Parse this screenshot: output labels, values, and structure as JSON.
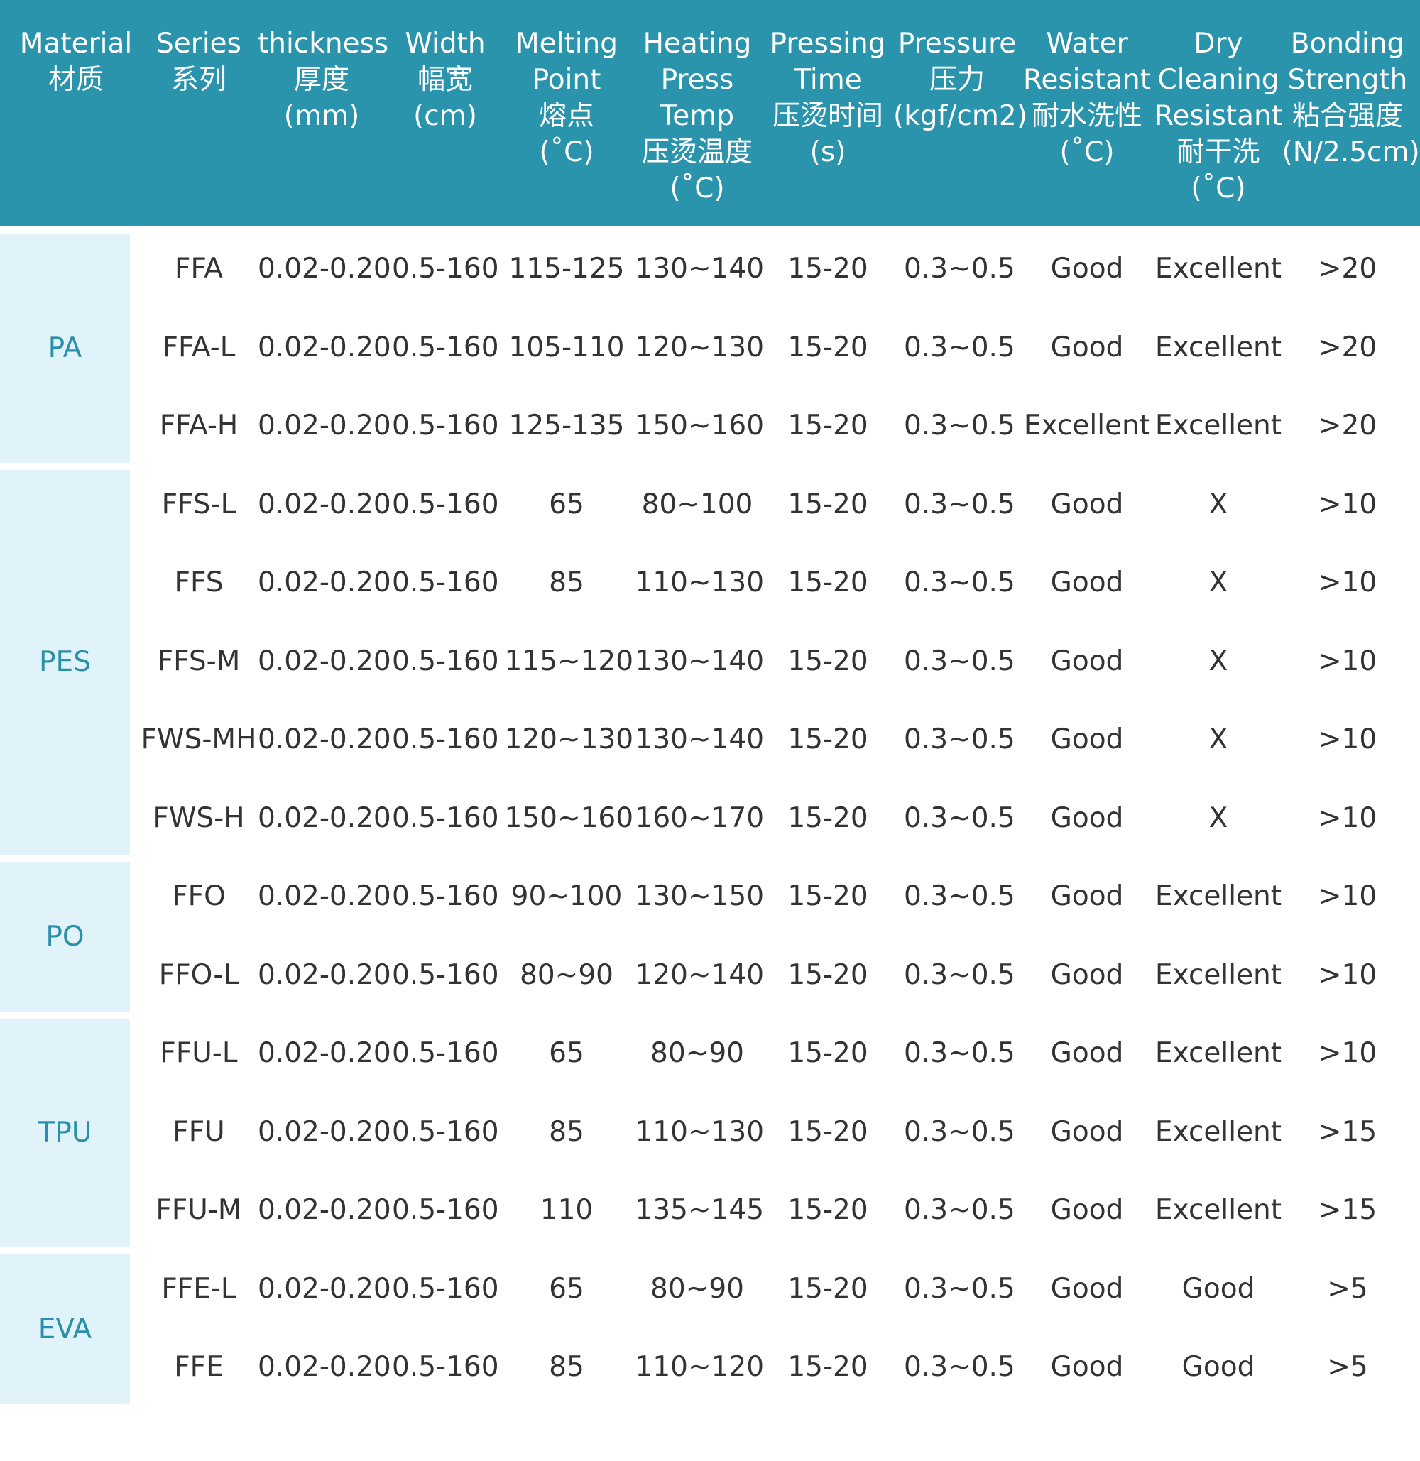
{
  "colors": {
    "header_bg": "#2a94ad",
    "header_text": "#ffffff",
    "group_bg": "#e1f3fa",
    "group_text": "#2a8fa8",
    "cell_text": "#333333"
  },
  "headers": [
    "Material\n材质",
    "Series\n系列",
    "thickness\n厚度\n(mm)",
    "Width\n幅宽\n(cm)",
    "Melting\nPoint\n熔点\n(˚C)",
    "Heating\nPress\nTemp\n压烫温度\n(˚C)",
    "Pressing\nTime\n压烫时间\n(s)",
    "Pressure\n压力\n(kgf/cm2)",
    "Water\nResistant\n耐水洗性\n(˚C)",
    "Dry\nCleaning\nResistant\n耐干洗\n(˚C)",
    "Bonding\nStrength\n粘合强度\n(N/2.5cm)"
  ],
  "groups": [
    {
      "material": "PA",
      "rows": [
        [
          "FFA",
          "0.02-0.20",
          "0.5-160",
          "115-125",
          "130~140",
          "15-20",
          "0.3~0.5",
          "Good",
          "Excellent",
          ">20"
        ],
        [
          "FFA-L",
          "0.02-0.20",
          "0.5-160",
          "105-110",
          "120~130",
          "15-20",
          "0.3~0.5",
          "Good",
          "Excellent",
          ">20"
        ],
        [
          "FFA-H",
          "0.02-0.20",
          "0.5-160",
          "125-135",
          "150~160",
          "15-20",
          "0.3~0.5",
          "Excellent",
          "Excellent",
          ">20"
        ]
      ]
    },
    {
      "material": "PES",
      "rows": [
        [
          "FFS-L",
          "0.02-0.20",
          "0.5-160",
          "65",
          "80~100",
          "15-20",
          "0.3~0.5",
          "Good",
          "X",
          ">10"
        ],
        [
          "FFS",
          "0.02-0.20",
          "0.5-160",
          "85",
          "110~130",
          "15-20",
          "0.3~0.5",
          "Good",
          "X",
          ">10"
        ],
        [
          "FFS-M",
          "0.02-0.20",
          "0.5-160",
          "115~120",
          "130~140",
          "15-20",
          "0.3~0.5",
          "Good",
          "X",
          ">10"
        ],
        [
          "FWS-MH",
          "0.02-0.20",
          "0.5-160",
          "120~130",
          "130~140",
          "15-20",
          "0.3~0.5",
          "Good",
          "X",
          ">10"
        ],
        [
          "FWS-H",
          "0.02-0.20",
          "0.5-160",
          "150~160",
          "160~170",
          "15-20",
          "0.3~0.5",
          "Good",
          "X",
          ">10"
        ]
      ]
    },
    {
      "material": "PO",
      "rows": [
        [
          "FFO",
          "0.02-0.20",
          "0.5-160",
          "90~100",
          "130~150",
          "15-20",
          "0.3~0.5",
          "Good",
          "Excellent",
          ">10"
        ],
        [
          "FFO-L",
          "0.02-0.20",
          "0.5-160",
          "80~90",
          "120~140",
          "15-20",
          "0.3~0.5",
          "Good",
          "Excellent",
          ">10"
        ]
      ]
    },
    {
      "material": "TPU",
      "rows": [
        [
          "FFU-L",
          "0.02-0.20",
          "0.5-160",
          "65",
          "80~90",
          "15-20",
          "0.3~0.5",
          "Good",
          "Excellent",
          ">10"
        ],
        [
          "FFU",
          "0.02-0.20",
          "0.5-160",
          "85",
          "110~130",
          "15-20",
          "0.3~0.5",
          "Good",
          "Excellent",
          ">15"
        ],
        [
          "FFU-M",
          "0.02-0.20",
          "0.5-160",
          "110",
          "135~145",
          "15-20",
          "0.3~0.5",
          "Good",
          "Excellent",
          ">15"
        ]
      ]
    },
    {
      "material": "EVA",
      "rows": [
        [
          "FFE-L",
          "0.02-0.20",
          "0.5-160",
          "65",
          "80~90",
          "15-20",
          "0.3~0.5",
          "Good",
          "Good",
          ">5"
        ],
        [
          "FFE",
          "0.02-0.20",
          "0.5-160",
          "85",
          "110~120",
          "15-20",
          "0.3~0.5",
          "Good",
          "Good",
          ">5"
        ]
      ]
    }
  ]
}
